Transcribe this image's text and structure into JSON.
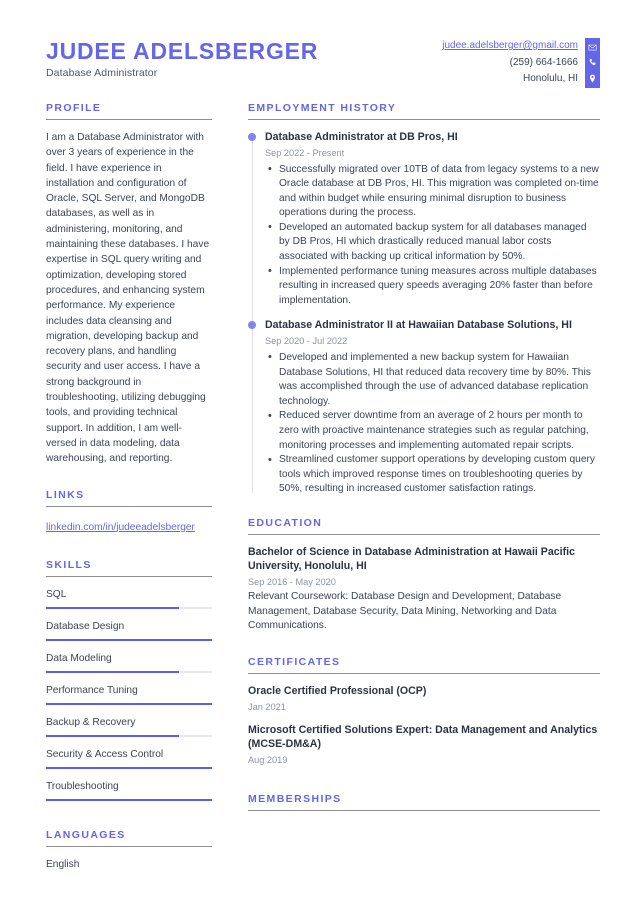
{
  "accent_color": "#6366e8",
  "header": {
    "name": "JUDEE ADELSBERGER",
    "title": "Database Administrator",
    "contact": {
      "email": "judee.adelsberger@gmail.com",
      "phone": "(259) 664-1666",
      "location": "Honolulu, HI"
    },
    "icons": [
      "envelope-icon",
      "phone-icon",
      "location-pin-icon"
    ]
  },
  "sidebar": {
    "profile": {
      "heading": "PROFILE",
      "text": "I am a Database Administrator with over 3 years of experience in the field. I have experience in installation and configuration of Oracle, SQL Server, and MongoDB databases, as well as in administering, monitoring, and maintaining these databases. I have expertise in SQL query writing and optimization, developing stored procedures, and enhancing system performance. My experience includes data cleansing and migration, developing backup and recovery plans, and handling security and user access. I have a strong background in troubleshooting, utilizing debugging tools, and providing technical support. In addition, I am well-versed in data modeling, data warehousing, and reporting."
    },
    "links": {
      "heading": "LINKS",
      "items": [
        {
          "label": "linkedin.com/in/judeeadelsberger"
        }
      ]
    },
    "skills": {
      "heading": "SKILLS",
      "items": [
        {
          "label": "SQL",
          "level": 80
        },
        {
          "label": "Database Design",
          "level": 100
        },
        {
          "label": "Data Modeling",
          "level": 80
        },
        {
          "label": "Performance Tuning",
          "level": 100
        },
        {
          "label": "Backup & Recovery",
          "level": 80
        },
        {
          "label": "Security & Access Control",
          "level": 100
        },
        {
          "label": "Troubleshooting",
          "level": 100
        }
      ]
    },
    "languages": {
      "heading": "LANGUAGES",
      "items": [
        {
          "label": "English"
        }
      ]
    }
  },
  "main": {
    "employment": {
      "heading": "EMPLOYMENT HISTORY",
      "jobs": [
        {
          "title": "Database Administrator at DB Pros, HI",
          "date": "Sep 2022 - Present",
          "bullets": [
            "Successfully migrated over 10TB of data from legacy systems to a new Oracle database at DB Pros, HI. This migration was completed on-time and within budget while ensuring minimal disruption to business operations during the process.",
            "Developed an automated backup system for all databases managed by DB Pros, HI which drastically reduced manual labor costs associated with backing up critical information by 50%.",
            "Implemented performance tuning measures across multiple databases resulting in increased query speeds averaging 20% faster than before implementation."
          ]
        },
        {
          "title": "Database Administrator II at Hawaiian Database Solutions, HI",
          "date": "Sep 2020 - Jul 2022",
          "bullets": [
            "Developed and implemented a new backup system for Hawaiian Database Solutions, HI that reduced data recovery time by 80%. This was accomplished through the use of advanced database replication technology.",
            "Reduced server downtime from an average of 2 hours per month to zero with proactive maintenance strategies such as regular patching, monitoring processes and implementing automated repair scripts.",
            "Streamlined customer support operations by developing custom query tools which improved response times on troubleshooting queries by 50%, resulting in increased customer satisfaction ratings."
          ]
        }
      ]
    },
    "education": {
      "heading": "EDUCATION",
      "entries": [
        {
          "title": "Bachelor of Science in Database Administration at Hawaii Pacific University, Honolulu, HI",
          "date": "Sep 2016 - May 2020",
          "description": "Relevant Coursework: Database Design and Development, Database Management, Database Security, Data Mining, Networking and Data Communications."
        }
      ]
    },
    "certificates": {
      "heading": "CERTIFICATES",
      "entries": [
        {
          "title": "Oracle Certified Professional (OCP)",
          "date": "Jan 2021"
        },
        {
          "title": "Microsoft Certified Solutions Expert: Data Management and Analytics (MCSE-DM&A)",
          "date": "Aug 2019"
        }
      ]
    },
    "memberships": {
      "heading": "MEMBERSHIPS"
    }
  }
}
